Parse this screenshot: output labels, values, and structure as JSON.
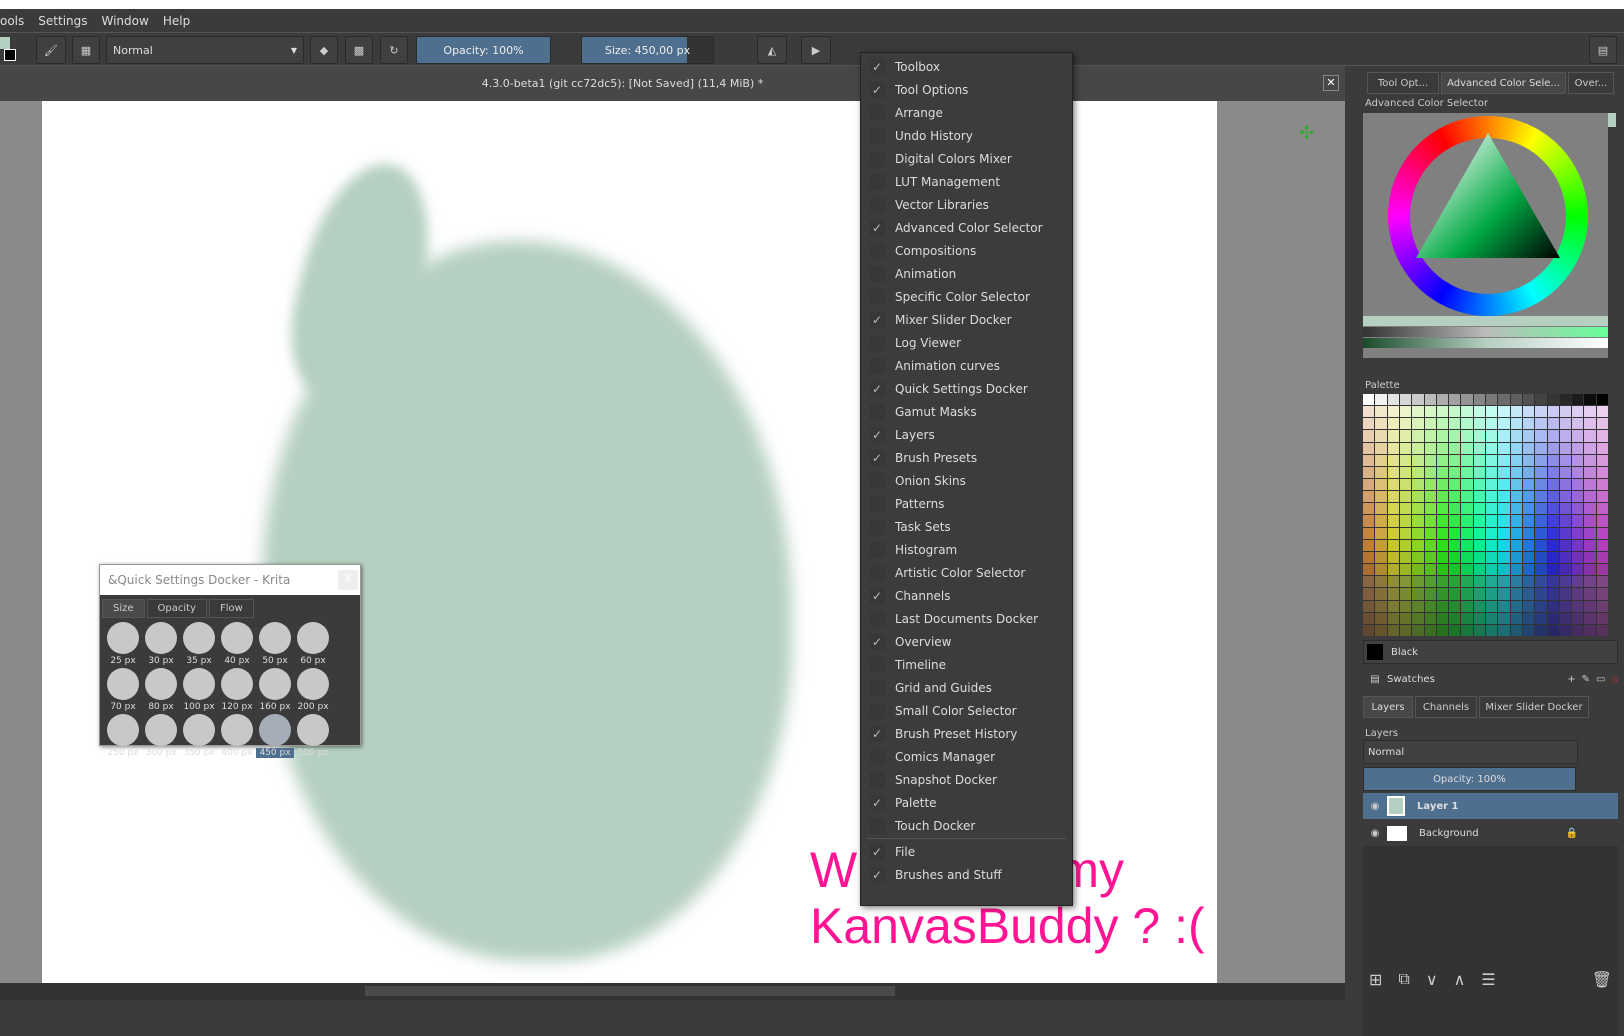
{
  "menubar": [
    "ools",
    "Settings",
    "Window",
    "Help"
  ],
  "toolbar": {
    "blend_mode": "Normal",
    "opacity": "Opacity: 100%",
    "size": "Size: 450,00 px"
  },
  "doc_title": "4.3.0-beta1 (git cc72dc5):  [Not Saved]  (11,4 MiB) *",
  "window_menu": [
    {
      "label": "Toolbox",
      "checked": true
    },
    {
      "label": "Tool Options",
      "checked": true
    },
    {
      "label": "Arrange",
      "checked": false
    },
    {
      "label": "Undo History",
      "checked": false
    },
    {
      "label": "Digital Colors Mixer",
      "checked": false
    },
    {
      "label": "LUT Management",
      "checked": false
    },
    {
      "label": "Vector Libraries",
      "checked": false
    },
    {
      "label": "Advanced Color Selector",
      "checked": true
    },
    {
      "label": "Compositions",
      "checked": false
    },
    {
      "label": "Animation",
      "checked": false
    },
    {
      "label": "Specific Color Selector",
      "checked": false
    },
    {
      "label": "Mixer Slider Docker",
      "checked": true
    },
    {
      "label": "Log Viewer",
      "checked": false
    },
    {
      "label": "Animation curves",
      "checked": false
    },
    {
      "label": "Quick Settings Docker",
      "checked": true
    },
    {
      "label": "Gamut Masks",
      "checked": false
    },
    {
      "label": "Layers",
      "checked": true
    },
    {
      "label": "Brush Presets",
      "checked": true
    },
    {
      "label": "Onion Skins",
      "checked": false
    },
    {
      "label": "Patterns",
      "checked": false
    },
    {
      "label": "Task Sets",
      "checked": false
    },
    {
      "label": "Histogram",
      "checked": false
    },
    {
      "label": "Artistic Color Selector",
      "checked": false
    },
    {
      "label": "Channels",
      "checked": true
    },
    {
      "label": "Last Documents Docker",
      "checked": false
    },
    {
      "label": "Overview",
      "checked": true
    },
    {
      "label": "Timeline",
      "checked": false
    },
    {
      "label": "Grid and Guides",
      "checked": false
    },
    {
      "label": "Small Color Selector",
      "checked": false
    },
    {
      "label": "Brush Preset History",
      "checked": true
    },
    {
      "label": "Comics Manager",
      "checked": false
    },
    {
      "label": "Snapshot Docker",
      "checked": false
    },
    {
      "label": "Palette",
      "checked": true
    },
    {
      "label": "Touch Docker",
      "checked": false
    }
  ],
  "window_menu_extra": [
    {
      "label": "File",
      "checked": true
    },
    {
      "label": "Brushes and Stuff",
      "checked": true
    }
  ],
  "annotation": [
    "Where are my",
    "KanvasBuddy ? :("
  ],
  "quick_settings": {
    "title": "&Quick Settings Docker - Krita",
    "close": "x",
    "tabs": [
      "Size",
      "Opacity",
      "Flow"
    ],
    "sizes": [
      "25 px",
      "30 px",
      "35 px",
      "40 px",
      "50 px",
      "60 px",
      "70 px",
      "80 px",
      "100 px",
      "120 px",
      "160 px",
      "200 px",
      "250 px",
      "300 px",
      "350 px",
      "400 px",
      "450 px",
      "500 px"
    ],
    "selected": "450 px"
  },
  "right_panel": {
    "tabs": [
      "Tool Opt...",
      "Advanced Color Sele...",
      "Over..."
    ],
    "color_selector_title": "Advanced Color Selector",
    "palette_title": "Palette",
    "palette_color_name": "Black",
    "swatches": "Swatches",
    "layer_tabs": [
      "Layers",
      "Channels",
      "Mixer Slider Docker"
    ],
    "layers_title": "Layers",
    "blend_mode": "Normal",
    "opacity": "Opacity:  100%",
    "layers": [
      {
        "name": "Layer 1",
        "selected": true
      },
      {
        "name": "Background",
        "selected": false
      }
    ]
  }
}
